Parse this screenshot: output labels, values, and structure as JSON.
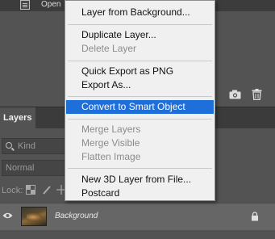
{
  "top_bar": {
    "open_label": "Open"
  },
  "layers_panel": {
    "tab_label": "Layers",
    "kind_placeholder": "Kind",
    "blend_mode": "Normal",
    "lock_label": "Lock:",
    "layer": {
      "name": "Background"
    }
  },
  "context_menu": {
    "items": [
      {
        "label": "Layer from Background...",
        "enabled": true
      },
      {
        "label": "Duplicate Layer...",
        "enabled": true
      },
      {
        "label": "Delete Layer",
        "enabled": false
      },
      {
        "label": "Quick Export as PNG",
        "enabled": true
      },
      {
        "label": "Export As...",
        "enabled": true
      },
      {
        "label": "Convert to Smart Object",
        "enabled": true,
        "highlighted": true
      },
      {
        "label": "Merge Layers",
        "enabled": false
      },
      {
        "label": "Merge Visible",
        "enabled": false
      },
      {
        "label": "Flatten Image",
        "enabled": false
      },
      {
        "label": "New 3D Layer from File...",
        "enabled": true
      },
      {
        "label": "Postcard",
        "enabled": true
      }
    ]
  },
  "colors": {
    "panel_bg": "#535353",
    "menu_bg": "#f0f0f0",
    "highlight": "#1e6fd9",
    "disabled_text": "#8c8c8c"
  }
}
